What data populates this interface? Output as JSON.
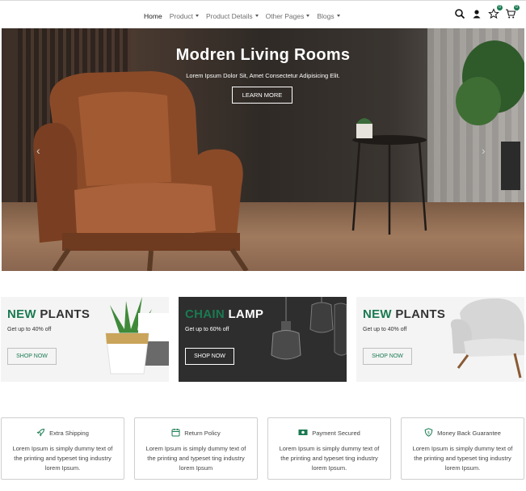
{
  "nav": {
    "links": [
      {
        "label": "Home",
        "caret": false
      },
      {
        "label": "Product",
        "caret": true
      },
      {
        "label": "Product Details",
        "caret": true
      },
      {
        "label": "Other Pages",
        "caret": true
      },
      {
        "label": "Blogs",
        "caret": true
      }
    ],
    "wishlist_count": "0",
    "cart_count": "0"
  },
  "hero": {
    "title": "Modren Living Rooms",
    "subtitle": "Lorem Ipsum Dolor Sit, Amet Consectetur Adipisicing Elit.",
    "button": "LEARN MORE",
    "prev_arrow": "‹",
    "next_arrow": "›"
  },
  "promos": [
    {
      "accent": "NEW",
      "rest": " PLANTS",
      "desc": "Get up to 40% off",
      "button": "SHOP NOW"
    },
    {
      "accent": "CHAIN",
      "rest": " LAMP",
      "desc": "Get up to 60% off",
      "button": "SHOP NOW"
    },
    {
      "accent": "NEW",
      "rest": " PLANTS",
      "desc": "Get up to 40% off",
      "button": "SHOP NOW"
    }
  ],
  "features": [
    {
      "title": "Extra Shipping",
      "icon": "rocket-icon",
      "desc": "Lorem Ipsum is simply dummy text of the printing and typeset ting industry lorem Ipsum."
    },
    {
      "title": "Return Policy",
      "icon": "calendar-icon",
      "desc": "Lorem Ipsum is simply dummy text of the printing and typeset ting industry lorem Ipsum"
    },
    {
      "title": "Payment Secured",
      "icon": "money-icon",
      "desc": "Lorem Ipsum is simply dummy text of the printing and typeset ting industry lorem Ipsum."
    },
    {
      "title": "Money Back Guarantee",
      "icon": "shield-icon",
      "desc": "Lorem Ipsum is simply dummy text of the printing and typeset ting industry lorem Ipsum."
    }
  ],
  "colors": {
    "accent": "#1a7a52",
    "dark_promo": "#2e2e2e",
    "light_promo": "#f4f4f4"
  }
}
